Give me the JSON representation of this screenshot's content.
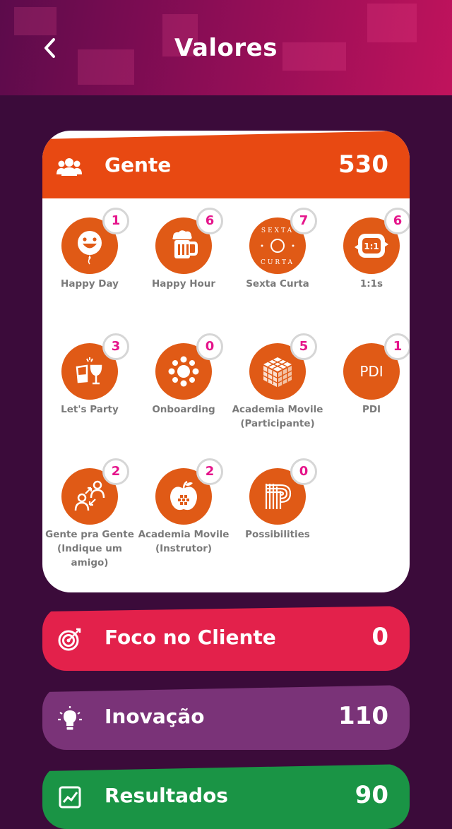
{
  "header": {
    "title": "Valores",
    "back_icon": "chevron-left-icon"
  },
  "main_card": {
    "title": "Gente",
    "score": "530",
    "color": "#e84912",
    "icon": "users-icon",
    "items": [
      {
        "label": "Happy Day",
        "count": "1",
        "icon": "smiley-balloon-icon"
      },
      {
        "label": "Happy Hour",
        "count": "6",
        "icon": "beer-mug-icon"
      },
      {
        "label": "Sexta Curta",
        "count": "7",
        "icon": "sexta-curta-logo-icon"
      },
      {
        "label": "1:1s",
        "count": "6",
        "icon": "one-on-one-icon"
      },
      {
        "label": "Let's Party",
        "count": "3",
        "icon": "toast-glasses-icon"
      },
      {
        "label": "Onboarding",
        "count": "0",
        "icon": "onboarding-table-icon"
      },
      {
        "label": "Academia Movile (Participante)",
        "count": "5",
        "icon": "rubik-cube-icon"
      },
      {
        "label": "PDI",
        "count": "1",
        "icon": "pdi-text-icon"
      },
      {
        "label": "Gente pra Gente (Indique um amigo)",
        "count": "2",
        "icon": "people-referral-icon"
      },
      {
        "label": "Academia Movile (Instrutor)",
        "count": "2",
        "icon": "apple-icon"
      },
      {
        "label": "Possibilities",
        "count": "0",
        "icon": "possibilities-logo-icon"
      }
    ],
    "pdi_text": "PDI",
    "one_on_one_text": "1:1",
    "sexta_text": "SEXTA CURTA"
  },
  "categories": [
    {
      "title": "Foco no Cliente",
      "score": "0",
      "color": "#e3214b",
      "icon": "target-icon"
    },
    {
      "title": "Inovação",
      "score": "110",
      "color": "#7a3378",
      "icon": "lightbulb-icon"
    },
    {
      "title": "Resultados",
      "score": "90",
      "color": "#1a9445",
      "icon": "chart-icon"
    }
  ],
  "colors": {
    "background": "#3b0b3a",
    "badge_text": "#e5158b",
    "icon_circle": "#e05a16"
  }
}
